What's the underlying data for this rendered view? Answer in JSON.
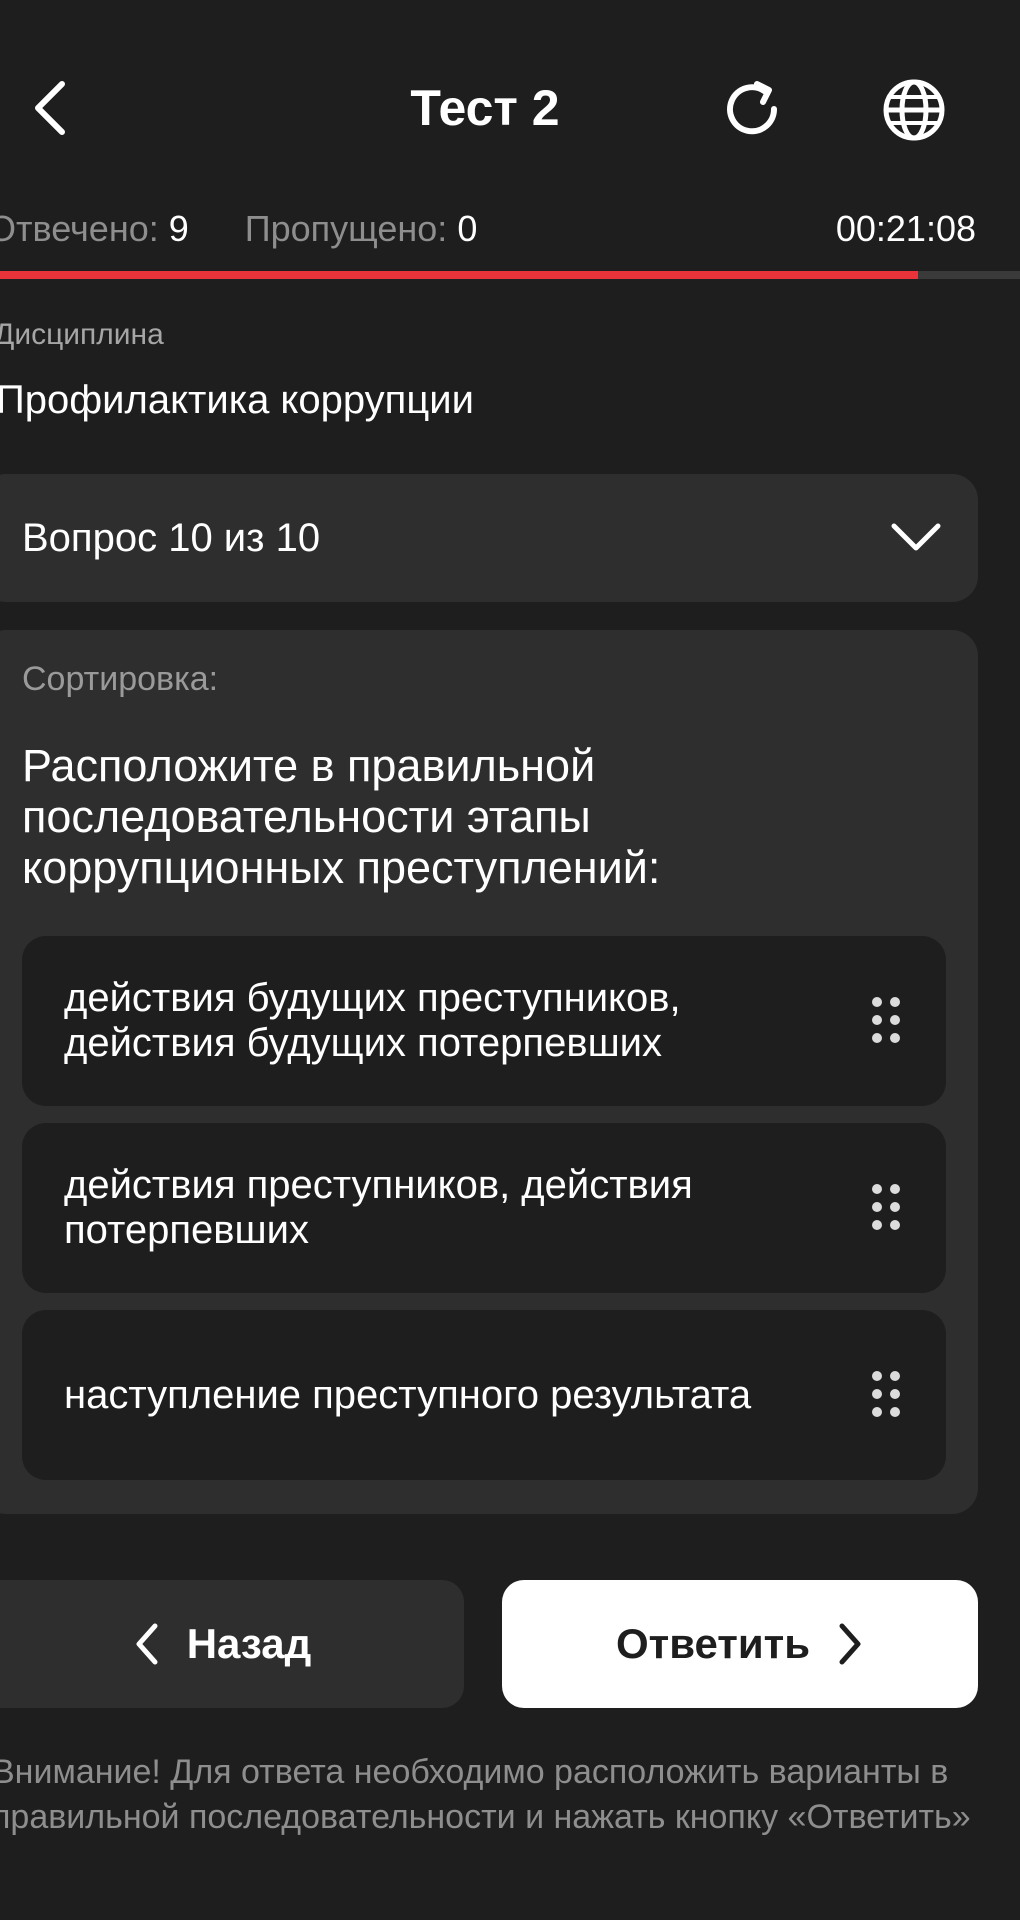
{
  "header": {
    "title": "Тест 2",
    "icons": {
      "back": "chevron-left-icon",
      "refresh": "refresh-icon",
      "language": "globe-icon"
    }
  },
  "stats": {
    "answered_label": "Отвечено:",
    "answered_value": "9",
    "skipped_label": "Пропущено:",
    "skipped_value": "0",
    "timer": "00:21:08"
  },
  "progress": {
    "fraction": 0.9,
    "color": "#e8333a"
  },
  "discipline": {
    "label": "Дисциплина",
    "name": "Профилактика коррупции"
  },
  "question_selector": {
    "label": "Вопрос 10 из 10"
  },
  "question": {
    "type_label": "Сортировка:",
    "text": "Расположите в правильной последовательности этапы коррупционных преступлений:",
    "options": [
      {
        "text": "действия будущих преступников, действия будущих потерпевших"
      },
      {
        "text": "действия преступников, действия потерпевших"
      },
      {
        "text": "наступление преступного результата"
      }
    ]
  },
  "buttons": {
    "back_label": "Назад",
    "answer_label": "Ответить"
  },
  "notice": "Внимание! Для ответа необходимо расположить варианты в правильной последовательности и нажать кнопку «Ответить»",
  "colors": {
    "background": "#1e1e1e",
    "card": "#2e2e2e",
    "accent": "#e8333a",
    "muted_text": "#8e8e8e"
  }
}
